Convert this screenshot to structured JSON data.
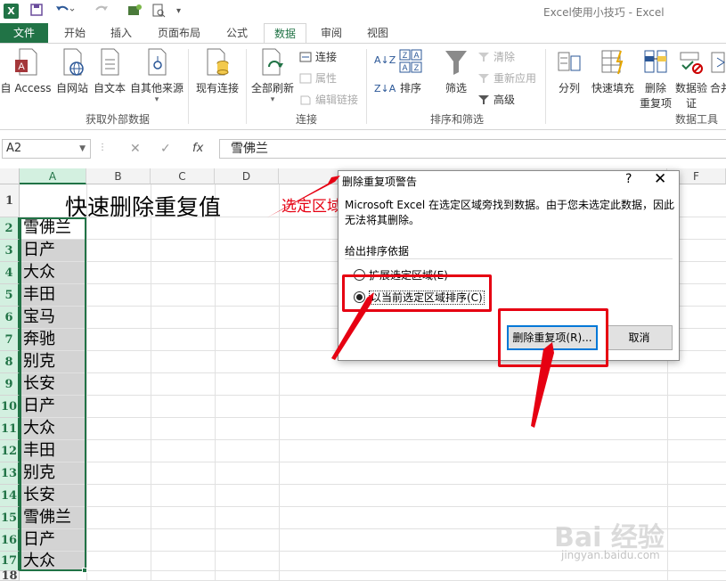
{
  "window": {
    "title": "Excel使用小技巧 - Excel",
    "logo": "X"
  },
  "qat": {
    "save_icon": "save-icon",
    "undo_icon": "undo-icon",
    "redo_icon": "redo-icon"
  },
  "tabs": [
    "文件",
    "开始",
    "插入",
    "页面布局",
    "公式",
    "数据",
    "审阅",
    "视图"
  ],
  "active_tab": "数据",
  "ribbon": {
    "get_external": {
      "buttons": [
        "自 Access",
        "自网站",
        "自文本",
        "自其他来源"
      ],
      "label": "获取外部数据"
    },
    "existing_connections": "现有连接",
    "connections": {
      "refresh_all": "全部刷新",
      "small": [
        "连接",
        "属性",
        "编辑链接"
      ],
      "label": "连接"
    },
    "sort_filter": {
      "sort": "排序",
      "filter": "筛选",
      "small": [
        "清除",
        "重新应用",
        "高级"
      ],
      "label": "排序和筛选"
    },
    "data_tools": {
      "buttons": [
        "分列",
        "快速填充",
        "删除",
        "重复项",
        "数据验",
        "证",
        "合并"
      ],
      "label": "数据工具"
    }
  },
  "formula_bar": {
    "name_box": "A2",
    "fx": "fx",
    "content": "雪佛兰"
  },
  "grid": {
    "columns": [
      "A",
      "B",
      "C",
      "D",
      "E",
      "F"
    ],
    "rows": [
      "1",
      "2",
      "3",
      "4",
      "5",
      "6",
      "7",
      "8",
      "9",
      "10",
      "11",
      "12",
      "13",
      "14",
      "15",
      "16",
      "17",
      "18"
    ],
    "title": "快速删除重复值",
    "annotation": "选定区域",
    "column_a": [
      "雪佛兰",
      "日产",
      "大众",
      "丰田",
      "宝马",
      "奔驰",
      "别克",
      "长安",
      "日产",
      "大众",
      "丰田",
      "别克",
      "长安",
      "雪佛兰",
      "日产",
      "大众"
    ]
  },
  "dialog": {
    "title": "删除重复项警告",
    "help": "?",
    "close": "✕",
    "message": "Microsoft Excel 在选定区域旁找到数据。由于您未选定此数据，因此无法将其删除。",
    "group_label": "给出排序依据",
    "option_expand": "扩展选定区域(E)",
    "option_current": "以当前选定区域排序(C)",
    "selected_option": "option_current",
    "btn_remove": "删除重复项(R)...",
    "btn_cancel": "取消"
  },
  "watermark": {
    "text": "Bai 经验",
    "sub": "jingyan.baidu.com"
  },
  "colors": {
    "excel_green": "#217346",
    "annotation_red": "#e60012"
  }
}
